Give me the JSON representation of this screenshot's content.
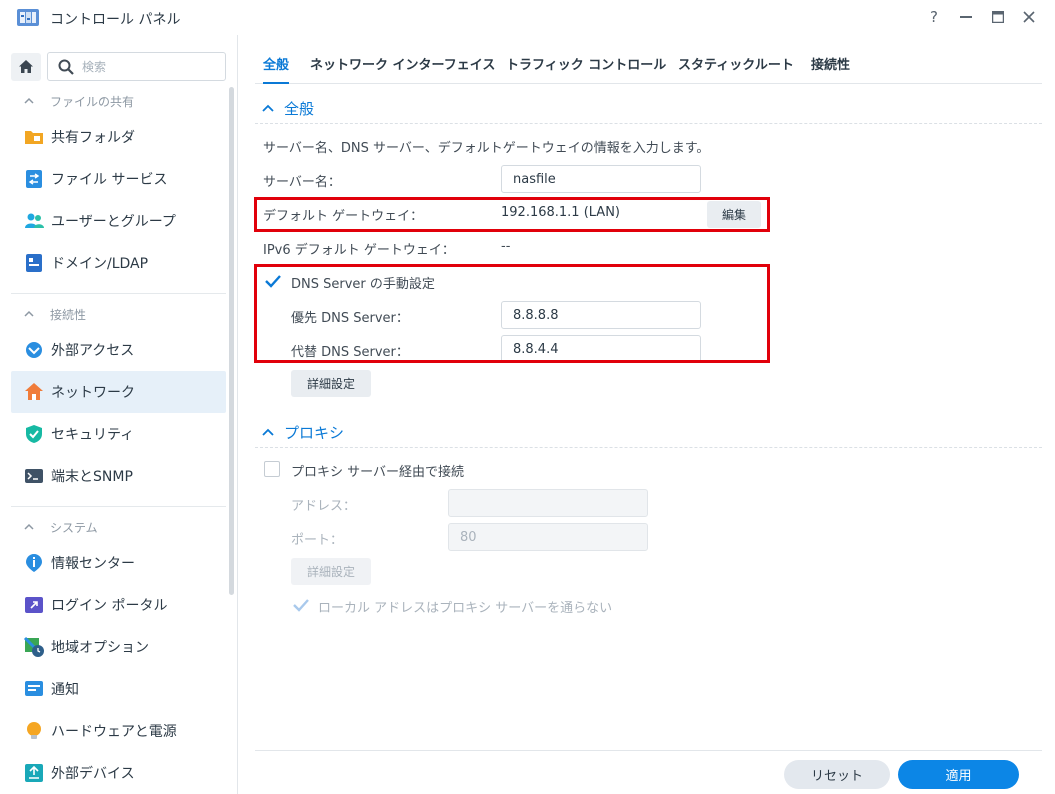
{
  "window": {
    "title": "コントロール パネル",
    "controls": {
      "help": "?",
      "minimize": "—",
      "maximize": "▣",
      "close": "✕"
    }
  },
  "sidebar": {
    "search_placeholder": "検索",
    "sections": [
      {
        "label": "ファイルの共有",
        "items": [
          "共有フォルダ",
          "ファイル サービス",
          "ユーザーとグループ",
          "ドメイン/LDAP"
        ]
      },
      {
        "label": "接続性",
        "items": [
          "外部アクセス",
          "ネットワーク",
          "セキュリティ",
          "端末とSNMP"
        ]
      },
      {
        "label": "システム",
        "items": [
          "情報センター",
          "ログイン ポータル",
          "地域オプション",
          "通知",
          "ハードウェアと電源",
          "外部デバイス"
        ]
      }
    ],
    "active_item": "ネットワーク"
  },
  "tabs": [
    "全般",
    "ネットワーク インターフェイス",
    "トラフィック コントロール",
    "スタティックルート",
    "接続性"
  ],
  "general": {
    "heading": "全般",
    "description": "サーバー名、DNS サーバー、デフォルトゲートウェイの情報を入力します。",
    "server_name_label": "サーバー名：",
    "server_name_value": "nasfile",
    "gateway_label": "デフォルト ゲートウェイ：",
    "gateway_value": "192.168.1.1 (LAN)",
    "edit_button": "編集",
    "ipv6_gateway_label": "IPv6 デフォルト ゲートウェイ：",
    "ipv6_gateway_value": "--",
    "dns_manual_label": "DNS Server の手動設定",
    "dns_manual_checked": true,
    "primary_dns_label": "優先 DNS Server：",
    "primary_dns_value": "8.8.8.8",
    "secondary_dns_label": "代替 DNS Server：",
    "secondary_dns_value": "8.8.4.4",
    "advanced_button": "詳細設定"
  },
  "proxy": {
    "heading": "プロキシ",
    "enable_label": "プロキシ サーバー経由で接続",
    "enable_checked": false,
    "address_label": "アドレス：",
    "address_value": "",
    "port_label": "ポート：",
    "port_value": "80",
    "advanced_button": "詳細設定",
    "bypass_label": "ローカル アドレスはプロキシ サーバーを通らない",
    "bypass_checked": true
  },
  "footer": {
    "reset_button": "リセット",
    "apply_button": "適用"
  },
  "colors": {
    "accent": "#0a79d6",
    "apply": "#0c86e6",
    "highlight": "#e1000a",
    "active_bg": "#e6f0f9"
  }
}
